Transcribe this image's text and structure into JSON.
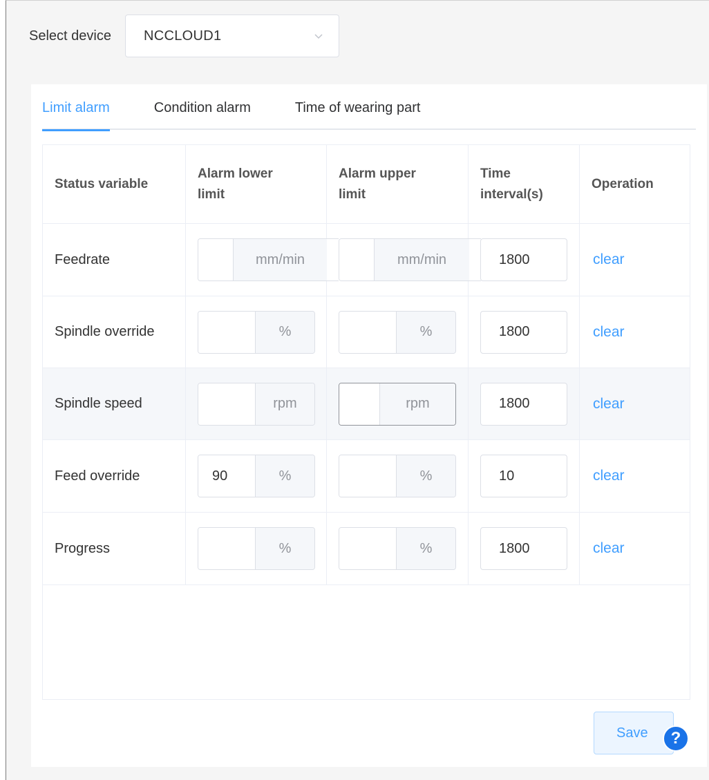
{
  "device": {
    "label": "Select device",
    "selected": "NCCLOUD1",
    "icon": "chevron-down-icon"
  },
  "tabs": [
    {
      "label": "Limit alarm",
      "active": true
    },
    {
      "label": "Condition alarm",
      "active": false
    },
    {
      "label": "Time of wearing part",
      "active": false
    }
  ],
  "table": {
    "headers": {
      "status": "Status variable",
      "lower_1": "Alarm lower",
      "lower_2": "limit",
      "upper_1": "Alarm upper",
      "upper_2": "limit",
      "time_1": "Time",
      "time_2": "interval(s)",
      "operation": "Operation"
    },
    "rows": [
      {
        "variable": "Feedrate",
        "lower": "",
        "upper": "",
        "unit": "mm/min",
        "interval": "1800",
        "action": "clear"
      },
      {
        "variable": "Spindle override",
        "lower": "",
        "upper": "",
        "unit": "%",
        "interval": "1800",
        "action": "clear"
      },
      {
        "variable": "Spindle speed",
        "lower": "",
        "upper": "",
        "unit": "rpm",
        "interval": "1800",
        "action": "clear"
      },
      {
        "variable": "Feed override",
        "lower": "90",
        "upper": "",
        "unit": "%",
        "interval": "10",
        "action": "clear"
      },
      {
        "variable": "Progress",
        "lower": "",
        "upper": "",
        "unit": "%",
        "interval": "1800",
        "action": "clear"
      }
    ]
  },
  "save_label": "Save",
  "help_glyph": "?",
  "colors": {
    "accent": "#409eff",
    "help": "#1a73e8",
    "hover_row": "#f5f7fa"
  }
}
